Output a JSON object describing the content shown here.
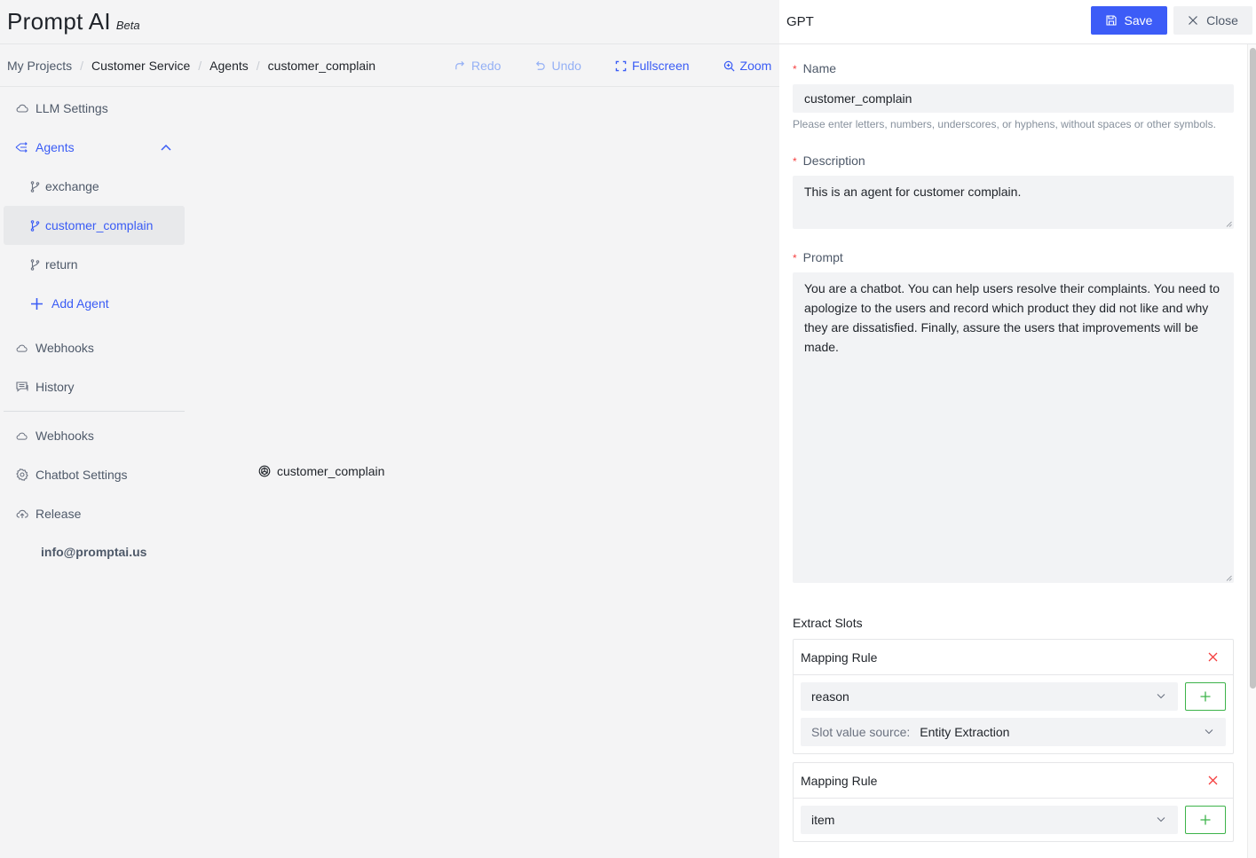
{
  "app": {
    "logo": "Prompt AI",
    "badge": "Beta"
  },
  "breadcrumb": [
    "My Projects",
    "Customer Service",
    "Agents",
    "customer_complain"
  ],
  "toolbar": {
    "redo": "Redo",
    "undo": "Undo",
    "fullscreen": "Fullscreen",
    "zoom": "Zoom"
  },
  "sidebar": {
    "llm_settings": "LLM Settings",
    "agents": "Agents",
    "agent_items": [
      "exchange",
      "customer_complain",
      "return"
    ],
    "selected_agent": "customer_complain",
    "add_agent": "Add Agent",
    "webhooks_1": "Webhooks",
    "history": "History",
    "webhooks_2": "Webhooks",
    "chatbot_settings": "Chatbot Settings",
    "release": "Release",
    "email": "info@promptai.us"
  },
  "canvas": {
    "node_label": "customer_complain"
  },
  "panel": {
    "title": "GPT",
    "save": "Save",
    "close": "Close",
    "name_label": "Name",
    "name_value": "customer_complain",
    "name_hint": "Please enter letters, numbers, underscores, or hyphens, without spaces or other symbols.",
    "description_label": "Description",
    "description_value": "This is an agent for customer complain.",
    "prompt_label": "Prompt",
    "prompt_value": "You are a chatbot. You can help users resolve their complaints. You need to apologize to the users and record which product they did not like and why they are dissatisfied. Finally, assure the users that improvements will be made.",
    "extract_slots_label": "Extract Slots",
    "rules": [
      {
        "title": "Mapping Rule",
        "slot": "reason",
        "source_label": "Slot value source:",
        "source_value": "Entity Extraction"
      },
      {
        "title": "Mapping Rule",
        "slot": "item"
      }
    ]
  },
  "colors": {
    "accent": "#3c5cf7",
    "danger": "#f53f3f",
    "success": "#3db34a"
  }
}
